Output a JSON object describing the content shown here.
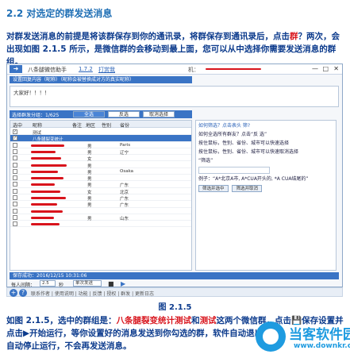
{
  "section_title": "2.2 对选定的群发送消息",
  "intro": {
    "before": "对群发送消息的前提是将该群保存到你的通讯录，将群保存到通讯录后，点击",
    "highlight": "群",
    "after": "？两次，会出现如图 2.1.5 所示，是微信群的会移动到最上面，您可以从中选择你需要发送消息的群组。"
  },
  "app": {
    "title": "八条腿微信助手",
    "version": "1.7.2",
    "version_link": "打赏我",
    "title_right": "机：",
    "window_controls": [
      "—",
      "□",
      "✕"
    ],
    "hint_bar": "设置回复内容（昵称）（昵称会被替换成对方的真实昵称）",
    "message_text": "大家好！！！！",
    "group_bar_label": "选择群发分组：1/625",
    "tabs": [
      "全选",
      "反选",
      "取消选择"
    ],
    "table_headers": [
      "选中",
      "昵称",
      "备注",
      "地区",
      "性别",
      "省份"
    ],
    "rows": [
      {
        "checked": "✓",
        "name": "测试",
        "remark": "",
        "gender": "",
        "region": "",
        "selected": false
      },
      {
        "checked": "✓",
        "name": "八条腿裂变统计",
        "remark": "",
        "gender": "",
        "region": "",
        "selected": true
      },
      {
        "checked": "",
        "name": "",
        "remark": "",
        "gender": "男",
        "region": "Paris",
        "selected": false
      },
      {
        "checked": "",
        "name": "",
        "remark": "",
        "gender": "男",
        "region": "辽宁",
        "selected": false
      },
      {
        "checked": "",
        "name": "",
        "remark": "",
        "gender": "女",
        "region": "",
        "selected": false
      },
      {
        "checked": "",
        "name": "",
        "remark": "",
        "gender": "男",
        "region": "",
        "selected": false
      },
      {
        "checked": "",
        "name": "",
        "remark": "",
        "gender": "男",
        "region": "Osaka",
        "selected": false
      },
      {
        "checked": "",
        "name": "",
        "remark": "",
        "gender": "男",
        "region": "",
        "selected": false
      },
      {
        "checked": "",
        "name": "",
        "remark": "",
        "gender": "男",
        "region": "广东",
        "selected": false
      },
      {
        "checked": "",
        "name": "",
        "remark": "",
        "gender": "女",
        "region": "北京",
        "selected": false
      },
      {
        "checked": "",
        "name": "",
        "remark": "",
        "gender": "男",
        "region": "广东",
        "selected": false
      },
      {
        "checked": "",
        "name": "",
        "remark": "",
        "gender": "男",
        "region": "广东",
        "selected": false
      },
      {
        "checked": "",
        "name": "",
        "remark": "",
        "gender": "",
        "region": "",
        "selected": false
      },
      {
        "checked": "",
        "name": "",
        "remark": "",
        "gender": "男",
        "region": "山东",
        "selected": false
      },
      {
        "checked": "",
        "name": "",
        "remark": "",
        "gender": "",
        "region": "",
        "selected": false
      }
    ],
    "side": {
      "q1": "如何筛选？点击表头 筛?",
      "q2": "如何全选所有群友？点击“反 选”",
      "q3": "按住鼠标，性别、省份、城市可以快速选择",
      "q4": "按住鼠标，性别、省份、城市可以快速取消选择",
      "hint": "“筛选”",
      "example": "例子：“A*北京A市, A*CUA开头的, *A CUA结尾的”",
      "btn1": "筛选并选中",
      "btn2": "筛选并取消"
    },
    "save_bar": "保存成功：2016/12/15 10:31:06",
    "controls": {
      "interval_label": "每人间隔：",
      "interval_value": "2.5",
      "interval_unit": "秒",
      "mode": "单次发送"
    },
    "bottom_links": "联系作者 | 使用说明 | 功能 | 反馈 | 授权 | 群发 | 更新日志"
  },
  "figure_caption": "图 2.1.5",
  "outro": {
    "p1": "如图 2.1.5，选中的群组是：",
    "g1": "八条腿裂变统计测试",
    "and": "和",
    "g2": "测试",
    "p2": "这两个微信群，点击",
    "save_icon": "💾",
    "p3": "保存设置并点击",
    "play_icon": "▶",
    "p4": "开始运行，等你设置好的消息发送到你勾选的群，软件自动退出并",
    "p5": "自动停止运行，不会再发送消息。"
  },
  "watermark": {
    "name": "当客软件园",
    "url": "www.downkr.com"
  }
}
